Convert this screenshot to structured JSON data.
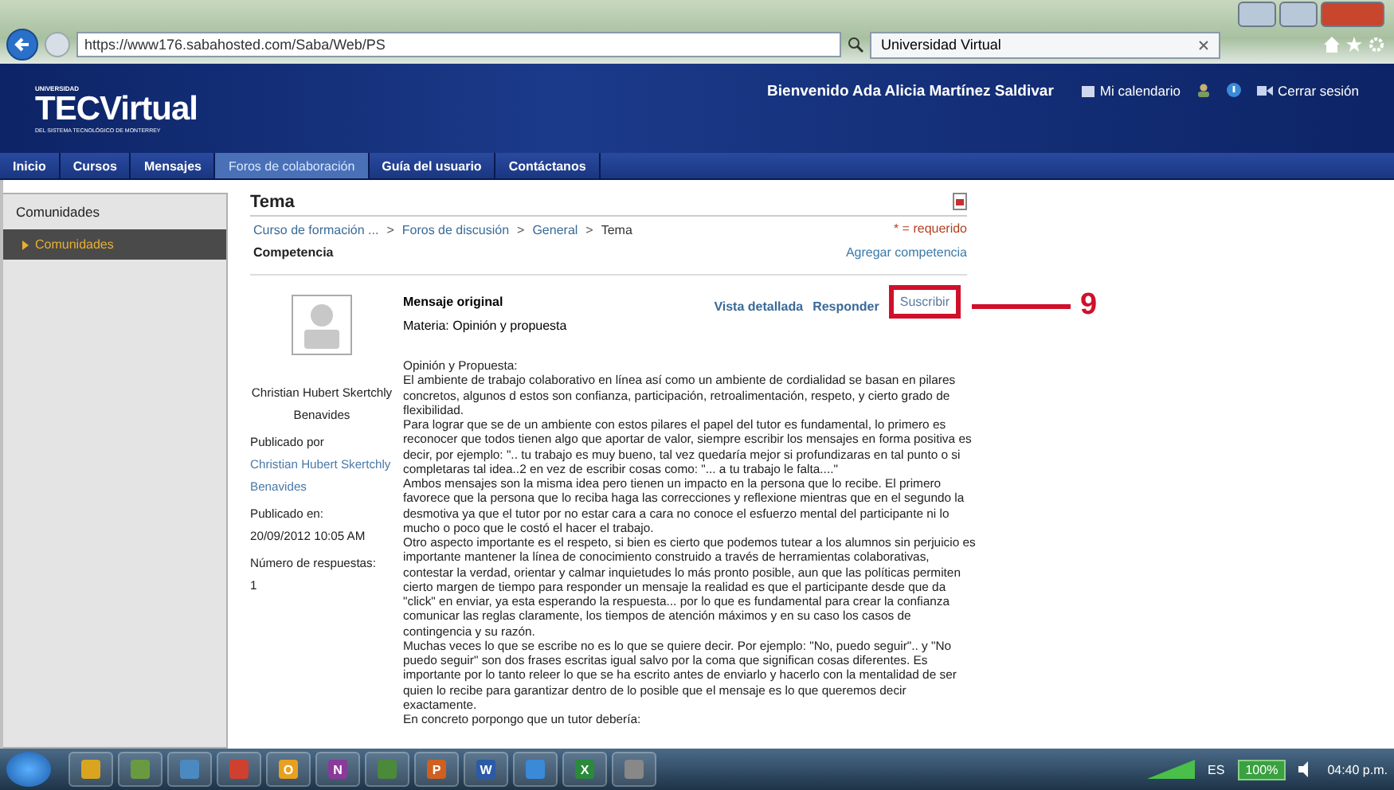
{
  "browser": {
    "url": "https://www176.sabahosted.com/Saba/Web/PS",
    "tab_title": "Universidad Virtual"
  },
  "header": {
    "logo_top": "UNIVERSIDAD",
    "logo": "TECVirtual",
    "logo_sub": "DEL SISTEMA TECNOLÓGICO DE MONTERREY",
    "welcome": "Bienvenido Ada Alicia Martínez Saldivar",
    "links": [
      {
        "label": "Mi calendario",
        "kind": "calendar"
      },
      {
        "kind": "user"
      },
      {
        "kind": "help"
      },
      {
        "label": "Cerrar sesión",
        "kind": "logout"
      }
    ]
  },
  "nav": [
    {
      "label": "Inicio",
      "selected": false
    },
    {
      "label": "Cursos",
      "selected": false
    },
    {
      "label": "Mensajes",
      "selected": false
    },
    {
      "label": "Foros de colaboración",
      "selected": true
    },
    {
      "label": "Guía del usuario",
      "selected": false
    },
    {
      "label": "Contáctanos",
      "selected": false
    }
  ],
  "sidebar": {
    "title": "Comunidades",
    "items": [
      {
        "label": "Comunidades",
        "selected": true
      }
    ]
  },
  "topic": {
    "title": "Tema",
    "breadcrumb": [
      "Curso de formación ...",
      "Foros de discusión",
      "General",
      "Tema"
    ],
    "breadcrumb_separator": ">",
    "required": "* = requerido",
    "competence": "Competencia",
    "add_competence": "Agregar competencia"
  },
  "message": {
    "heading": "Mensaje original",
    "subject": "Materia:  Opinión y propuesta",
    "actions": [
      {
        "label": "Vista detallada",
        "highlighted": false
      },
      {
        "label": "Responder",
        "highlighted": false
      },
      {
        "label": "Suscribir",
        "highlighted": true
      }
    ],
    "author": "Christian Hubert Skertchly Benavides",
    "published_by_label": "Publicado por",
    "published_by": "Christian Hubert Skertchly Benavides",
    "published_on_label": "Publicado en:",
    "published_on": "20/09/2012  10:05 AM",
    "replies_label": "Número de respuestas:",
    "replies": "1",
    "body_title": "Opinión y Propuesta:",
    "paragraphs": [
      "El ambiente de trabajo colaborativo en línea así como un ambiente de cordialidad se basan en pilares concretos, algunos d estos son confianza, participación, retroalimentación, respeto, y cierto grado de flexibilidad.",
      "Para lograr que se de un ambiente con estos pilares el papel del tutor es fundamental, lo primero es reconocer que todos tienen algo que aportar de valor, siempre escribir los mensajes en forma positiva es decir, por ejemplo: \".. tu trabajo es muy bueno, tal vez quedaría mejor si profundizaras en tal punto o si completaras tal idea..2 en vez de escribir cosas como: \"... a tu trabajo le falta....\"",
      "Ambos mensajes son la misma idea pero tienen un impacto en la persona que lo recibe. El primero favorece que la persona que lo reciba haga las correcciones y reflexione mientras que en el segundo la desmotiva ya que el tutor por no estar cara a cara no conoce el esfuerzo mental del participante ni lo mucho o poco que le costó el hacer el trabajo.",
      "Otro aspecto importante es el respeto, si bien es cierto que podemos tutear a los alumnos sin perjuicio es importante mantener la línea de conocimiento construido a través de herramientas colaborativas, contestar la verdad, orientar y calmar inquietudes lo más pronto posible, aun que las políticas permiten cierto margen de tiempo para responder un mensaje la realidad es que el participante desde que da \"click\" en enviar, ya esta esperando la respuesta... por lo que es fundamental para crear la confianza comunicar las reglas claramente, los tiempos de atención máximos y en su caso los casos de contingencia y su razón.",
      "Muchas veces lo que se escribe no es lo que se quiere decir. Por ejemplo: \"No, puedo seguir\".. y \"No puedo seguir\" son dos frases escritas igual salvo por la coma que significan cosas diferentes. Es importante por lo tanto releer lo que se ha escrito antes de enviarlo y hacerlo con la mentalidad de ser quien lo recibe para garantizar dentro de lo posible que el mensaje es lo que queremos decir exactamente.",
      "En concreto porpongo que un tutor debería:"
    ]
  },
  "callout": {
    "number": "9"
  },
  "taskbar": {
    "apps": [
      {
        "color": "#d9a520"
      },
      {
        "color": "#6a9a40"
      },
      {
        "color": "#4a8ac0"
      },
      {
        "color": "#d04030"
      },
      {
        "label": "O",
        "color": "#e8a020"
      },
      {
        "label": "N",
        "color": "#8a3a9a"
      },
      {
        "color": "#4a8a3a"
      },
      {
        "label": "P",
        "color": "#d06020"
      },
      {
        "label": "W",
        "color": "#2a5aa8"
      },
      {
        "color": "#3a8ad8"
      },
      {
        "label": "X",
        "color": "#2a8a3a"
      },
      {
        "color": "#888888"
      }
    ],
    "lang": "ES",
    "battery": "100%",
    "clock": "04:40 p.m."
  }
}
